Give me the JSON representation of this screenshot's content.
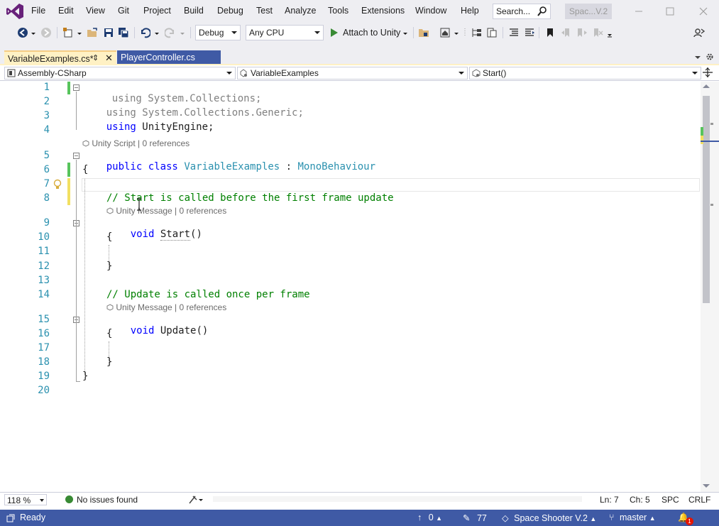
{
  "menu": {
    "items": [
      "File",
      "Edit",
      "View",
      "Git",
      "Project",
      "Build",
      "Debug",
      "Test",
      "Analyze",
      "Tools",
      "Extensions",
      "Window",
      "Help"
    ],
    "search_placeholder": "Search...",
    "solution_name": "Spac...V.2"
  },
  "toolbar": {
    "configuration": "Debug",
    "platform": "Any CPU",
    "attach_label": "Attach to Unity"
  },
  "tabs": [
    {
      "label": "VariableExamples.cs*",
      "active": true
    },
    {
      "label": "PlayerController.cs",
      "active": false
    }
  ],
  "navbar": {
    "project": "Assembly-CSharp",
    "class": "VariableExamples",
    "member": "Start()"
  },
  "editor": {
    "line_numbers": [
      "1",
      "2",
      "3",
      "4",
      "5",
      "6",
      "7",
      "8",
      "9",
      "10",
      "11",
      "12",
      "13",
      "14",
      "15",
      "16",
      "17",
      "18",
      "19",
      "20"
    ],
    "code": {
      "l1_kw": "using",
      "l1_rest": " System.Collections;",
      "l2_kw": "using",
      "l2_rest": " System.Collections.Generic;",
      "l3_kw": "using",
      "l3_rest": " UnityEngine;",
      "l5_kw": "public class",
      "l5_name": "VariableExamples",
      "l5_sep": " : ",
      "l5_base": "MonoBehaviour",
      "l6": "{",
      "l8": "// Start is called before the first frame update",
      "l9_kw": "void",
      "l9_name": "Start",
      "l9_rest": "()",
      "l10": "{",
      "l12": "}",
      "l14": "// Update is called once per frame",
      "l15_kw": "void",
      "l15_name": "Update",
      "l15_rest": "()",
      "l16": "{",
      "l18": "}",
      "l19": "}"
    },
    "codelens": {
      "class_lens": "Unity Script | 0 references",
      "start_lens": "Unity Message | 0 references",
      "update_lens": "Unity Message | 0 references"
    }
  },
  "editor_status": {
    "zoom": "118 %",
    "issues": "No issues found",
    "line": "Ln: 7",
    "col": "Ch: 5",
    "indent": "SPC",
    "eol": "CRLF"
  },
  "statusbar": {
    "state": "Ready",
    "push_count": "0",
    "changes_count": "77",
    "repo": "Space Shooter V.2",
    "branch": "master",
    "notifications": "1"
  },
  "colors": {
    "accent": "#3f5aa5",
    "active_tab": "#fff1c4",
    "change_saved": "#57c45c",
    "change_unsaved": "#f2e062"
  }
}
